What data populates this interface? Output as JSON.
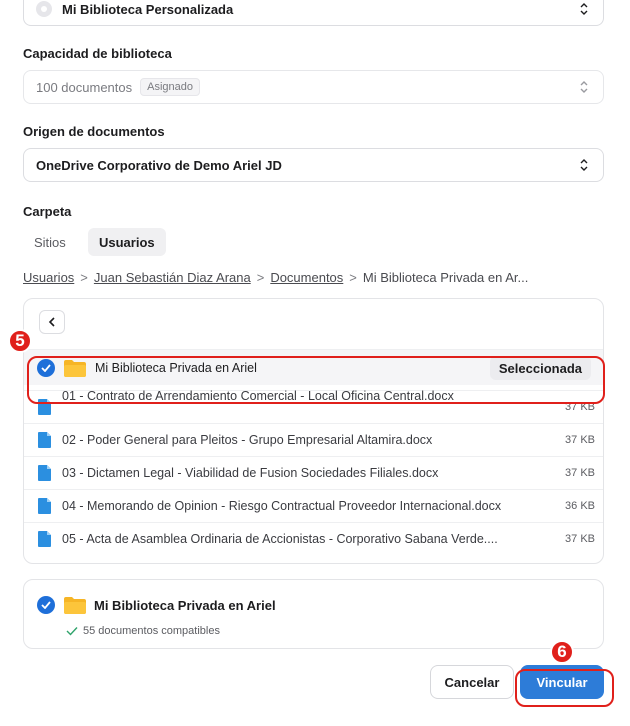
{
  "library_select": {
    "value": "Mi Biblioteca Personalizada"
  },
  "capacity": {
    "label": "Capacidad de biblioteca",
    "value": "100 documentos",
    "badge": "Asignado"
  },
  "origin": {
    "label": "Origen de documentos",
    "value": "OneDrive Corporativo de Demo Ariel JD"
  },
  "folder": {
    "label": "Carpeta",
    "tabs": [
      {
        "label": "Sitios",
        "active": false
      },
      {
        "label": "Usuarios",
        "active": true
      }
    ]
  },
  "breadcrumb": {
    "items": [
      "Usuarios",
      "Juan Sebastián Diaz Arana",
      "Documentos"
    ],
    "current": "Mi Biblioteca Privada en Ar...",
    "separator": ">"
  },
  "browser": {
    "selected_folder": {
      "name": "Mi Biblioteca Privada en Ariel",
      "button_label": "Seleccionada"
    },
    "files": [
      {
        "name": "01 - Contrato de Arrendamiento Comercial - Local Oficina Central.docx",
        "size": "37 KB"
      },
      {
        "name": "02 - Poder General para Pleitos - Grupo Empresarial Altamira.docx",
        "size": "37 KB"
      },
      {
        "name": "03 - Dictamen Legal - Viabilidad de Fusion Sociedades Filiales.docx",
        "size": "37 KB"
      },
      {
        "name": "04 - Memorando de Opinion - Riesgo Contractual Proveedor Internacional.docx",
        "size": "36 KB"
      },
      {
        "name": "05 - Acta de Asamblea Ordinaria de Accionistas - Corporativo Sabana Verde....",
        "size": "37 KB"
      }
    ]
  },
  "summary": {
    "folder_name": "Mi Biblioteca Privada en Ariel",
    "compatible": "55 documentos compatibles"
  },
  "actions": {
    "cancel": "Cancelar",
    "link": "Vincular"
  },
  "annotations": {
    "step5": "5",
    "step6": "6"
  },
  "colors": {
    "accent": "#2d7cd8",
    "annotation": "#e0201b",
    "folder": "#f6b526"
  }
}
